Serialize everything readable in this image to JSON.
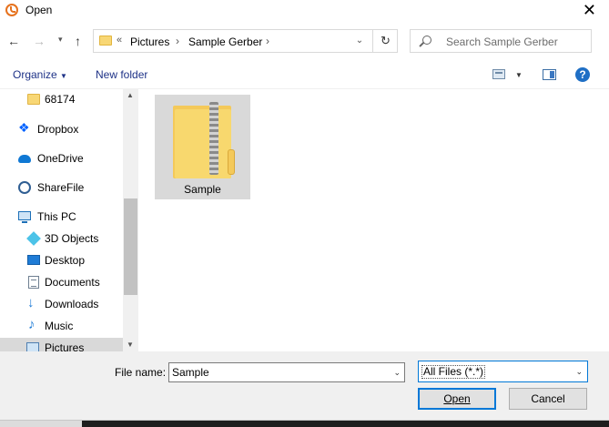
{
  "window": {
    "title": "Open",
    "close_glyph": "✕"
  },
  "nav": {
    "back_glyph": "←",
    "forward_glyph": "→",
    "dropdown_glyph": "▾",
    "up_glyph": "↑",
    "address": {
      "overflow_glyph": "«",
      "crumbs": [
        "Pictures",
        "Sample Gerber"
      ],
      "separator": "›",
      "dropdown_glyph": "⌄",
      "refresh_glyph": "↻"
    },
    "search": {
      "placeholder": "Search Sample Gerber"
    }
  },
  "toolbar": {
    "organize_label": "Organize",
    "organize_caret": "▼",
    "new_folder_label": "New folder",
    "view_caret": "▼",
    "help_glyph": "?"
  },
  "sidebar": {
    "items": [
      {
        "label": "68174",
        "icon": "folder-icon"
      },
      {
        "label": "Dropbox",
        "icon": "dropbox-icon",
        "glyph": "❖"
      },
      {
        "label": "OneDrive",
        "icon": "onedrive-icon"
      },
      {
        "label": "ShareFile",
        "icon": "sharefile-icon"
      },
      {
        "label": "This PC",
        "icon": "computer-icon"
      },
      {
        "label": "3D Objects",
        "icon": "3d-objects-icon"
      },
      {
        "label": "Desktop",
        "icon": "desktop-icon"
      },
      {
        "label": "Documents",
        "icon": "documents-icon"
      },
      {
        "label": "Downloads",
        "icon": "downloads-icon",
        "glyph": "↓"
      },
      {
        "label": "Music",
        "icon": "music-icon",
        "glyph": "♪"
      },
      {
        "label": "Pictures",
        "icon": "pictures-icon",
        "selected": true
      }
    ],
    "scroll_up_glyph": "▲",
    "scroll_down_glyph": "▼"
  },
  "content": {
    "items": [
      {
        "label": "Sample",
        "icon": "zip-folder-icon",
        "selected": true
      }
    ]
  },
  "footer": {
    "file_name_label": "File name:",
    "file_name_value": "Sample",
    "file_name_caret": "⌄",
    "file_type_value": "All Files (*.*)",
    "file_type_caret": "⌄",
    "open_label": "Open",
    "cancel_label": "Cancel"
  }
}
